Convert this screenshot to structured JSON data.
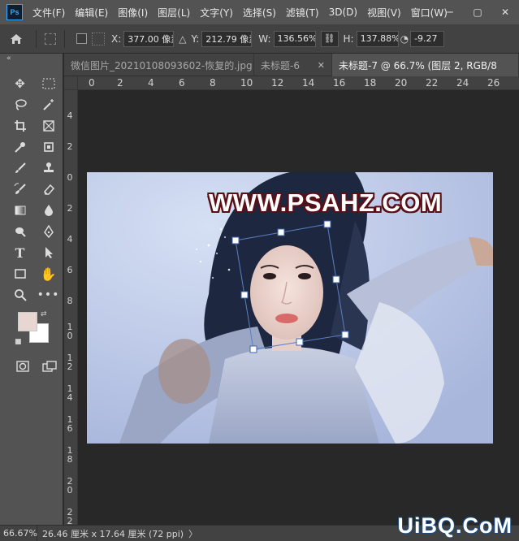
{
  "app": {
    "logo": "Ps"
  },
  "menu": [
    "文件(F)",
    "编辑(E)",
    "图像(I)",
    "图层(L)",
    "文字(Y)",
    "选择(S)",
    "滤镜(T)",
    "3D(D)",
    "视图(V)",
    "窗口(W)"
  ],
  "window_controls": {
    "minimize": "─",
    "maximize": "▢",
    "close": "✕"
  },
  "options": {
    "x_label": "X:",
    "x_value": "377.00 像素",
    "y_label": "Y:",
    "y_value": "212.79 像素",
    "w_label": "W:",
    "w_value": "136.56%",
    "h_label": "H:",
    "h_value": "137.88%",
    "angle_value": "-9.27"
  },
  "toolbar": {
    "collapse": "«"
  },
  "tabs": [
    {
      "label": "微信图片_20210108093602-恢复的.jpg",
      "close": "✕",
      "active": false
    },
    {
      "label": "未标题-6",
      "close": "✕",
      "active": false
    },
    {
      "label": "未标题-7 @ 66.7% (图层 2, RGB/8",
      "close": "",
      "active": true
    }
  ],
  "ruler_top": [
    "0",
    "2",
    "4",
    "6",
    "8",
    "10",
    "12",
    "14",
    "16",
    "18",
    "20",
    "22",
    "24",
    "26"
  ],
  "ruler_left": [
    "4",
    "2",
    "0",
    "2",
    "4",
    "6",
    "8",
    "1\n0",
    "1\n2",
    "1\n4",
    "1\n6",
    "1\n8",
    "2\n0",
    "2\n2"
  ],
  "canvas": {
    "watermark": "WWW.PSAHZ.COM"
  },
  "status": {
    "zoom": "66.67%",
    "doc_info": "26.46 厘米 x 17.64 厘米 (72 ppi)",
    "arrow": "〉"
  },
  "site_logo": "UiBQ.CoM",
  "colors": {
    "foreground": "#e8d6d2",
    "background": "#ffffff",
    "accent": "#31a8ff"
  }
}
